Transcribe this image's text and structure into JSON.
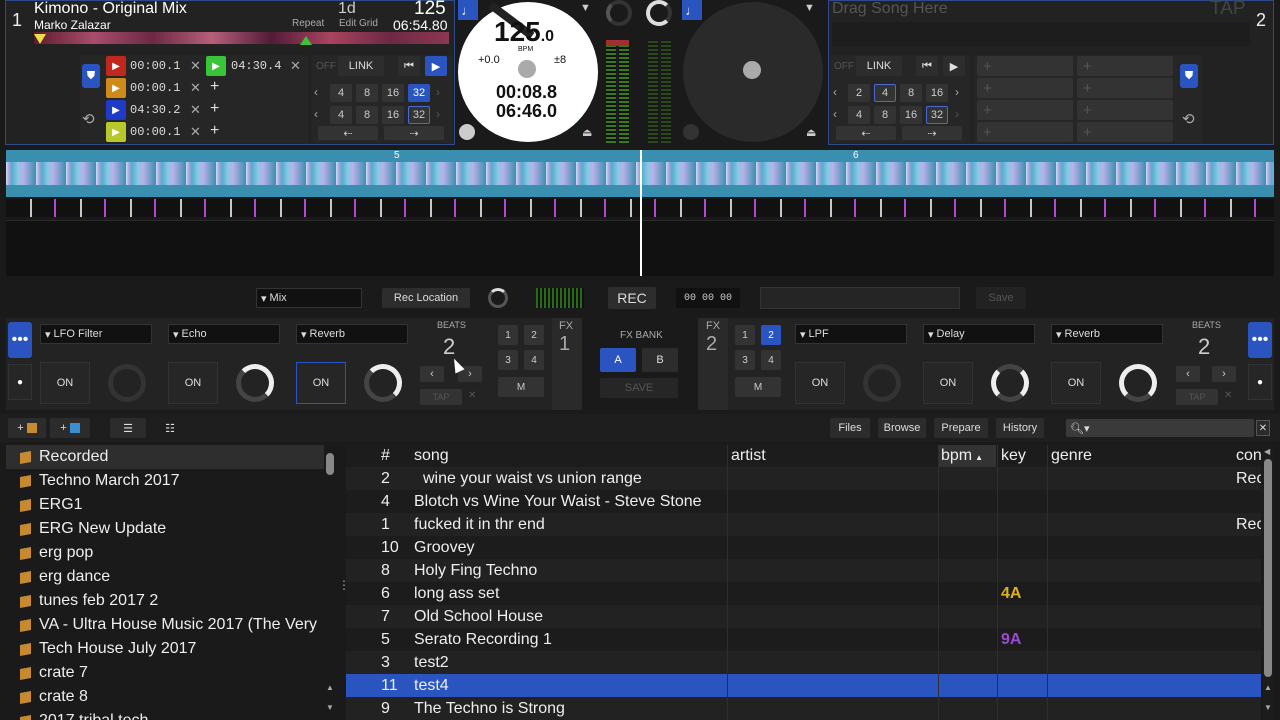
{
  "deck1": {
    "number": "1",
    "title": "Kimono - Original Mix",
    "artist": "Marko Zalazar",
    "key_label": "1d",
    "repeat": "Repeat",
    "edit_grid": "Edit Grid",
    "bpm": "125",
    "time": "06:54.80",
    "cues": [
      {
        "time": "00:00.1",
        "color": "#c0281e"
      },
      {
        "time": "00:00.1",
        "color": "#d08a1a"
      },
      {
        "time": "04:30.2",
        "color": "#1f3ac4"
      },
      {
        "time": "00:00.1",
        "color": "#b8c82a"
      }
    ],
    "cue5": "04:30.4",
    "off": "OFF",
    "link": "LINK",
    "loop_row1": [
      "4",
      "8",
      "16",
      "32"
    ],
    "loop_row2": [
      "4",
      "8",
      "16",
      "32"
    ]
  },
  "platter1": {
    "bpm": "125",
    "bpm_dec": ".0",
    "bpm_unit": "BPM",
    "pitch": "+0.0",
    "range": "±8",
    "elapsed": "00:08.8",
    "remaining": "06:46.0"
  },
  "deck2": {
    "number": "2",
    "placeholder": "Drag Song Here",
    "tap": "TAP",
    "off": "OFF",
    "link": "LINK",
    "loop_row1": [
      "2",
      "4",
      "8",
      "16"
    ],
    "loop_row2": [
      "4",
      "8",
      "16",
      "32"
    ]
  },
  "waveform": {
    "beat_marker_1": "5",
    "beat_marker_2": "6"
  },
  "recorder": {
    "mix": "Mix",
    "rec_location": "Rec Location",
    "rec": "REC",
    "time": "00 00 00",
    "save": "Save"
  },
  "fx1": {
    "label": "FX",
    "number": "1",
    "slots": [
      "LFO Filter",
      "Echo",
      "Reverb"
    ],
    "on": "ON",
    "beats_label": "BEATS",
    "beats": "2",
    "tap": "TAP",
    "assign": [
      "1",
      "2",
      "3",
      "4"
    ],
    "m": "M"
  },
  "fx_bank": {
    "label": "FX BANK",
    "a": "A",
    "b": "B",
    "save": "SAVE"
  },
  "fx2": {
    "label": "FX",
    "number": "2",
    "slots": [
      "LPF",
      "Delay",
      "Reverb"
    ],
    "on": "ON",
    "beats_label": "BEATS",
    "beats": "2",
    "tap": "TAP",
    "assign": [
      "1",
      "2",
      "3",
      "4"
    ],
    "m": "M"
  },
  "library_tabs": {
    "files": "Files",
    "browse": "Browse",
    "prepare": "Prepare",
    "history": "History"
  },
  "search": {
    "placeholder": ""
  },
  "crates": [
    "Recorded",
    "Techno March 2017",
    "ERG1",
    "ERG New Update",
    "erg pop",
    "erg dance",
    "tunes feb 2017 2",
    "VA - Ultra House Music 2017 (The Very",
    "Tech House July 2017",
    "crate 7",
    "crate 8",
    "2017 tribal tech"
  ],
  "columns": {
    "num": "#",
    "song": "song",
    "artist": "artist",
    "bpm": "bpm",
    "key": "key",
    "genre": "genre",
    "comment": "con"
  },
  "tracks": [
    {
      "num": "2",
      "song": "wine your waist vs union range",
      "key": "",
      "rec": "Rec",
      "indent": true
    },
    {
      "num": "4",
      "song": "Blotch vs Wine Your Waist - Steve Stone",
      "key": "",
      "rec": ""
    },
    {
      "num": "1",
      "song": "fucked it in thr end",
      "key": "",
      "rec": "Rec"
    },
    {
      "num": "10",
      "song": "Groovey",
      "key": "",
      "rec": ""
    },
    {
      "num": "8",
      "song": "Holy Fing Techno",
      "key": "",
      "rec": ""
    },
    {
      "num": "6",
      "song": "long ass set",
      "key": "4A",
      "key_color": "#e0b020",
      "rec": ""
    },
    {
      "num": "7",
      "song": "Old School House",
      "key": "",
      "rec": ""
    },
    {
      "num": "5",
      "song": "Serato Recording 1",
      "key": "9A",
      "key_color": "#9a4ad0",
      "rec": ""
    },
    {
      "num": "3",
      "song": "test2",
      "key": "",
      "rec": ""
    },
    {
      "num": "11",
      "song": "test4",
      "key": "",
      "rec": "",
      "selected": true
    },
    {
      "num": "9",
      "song": "The Techno is Strong",
      "key": "",
      "rec": ""
    }
  ]
}
